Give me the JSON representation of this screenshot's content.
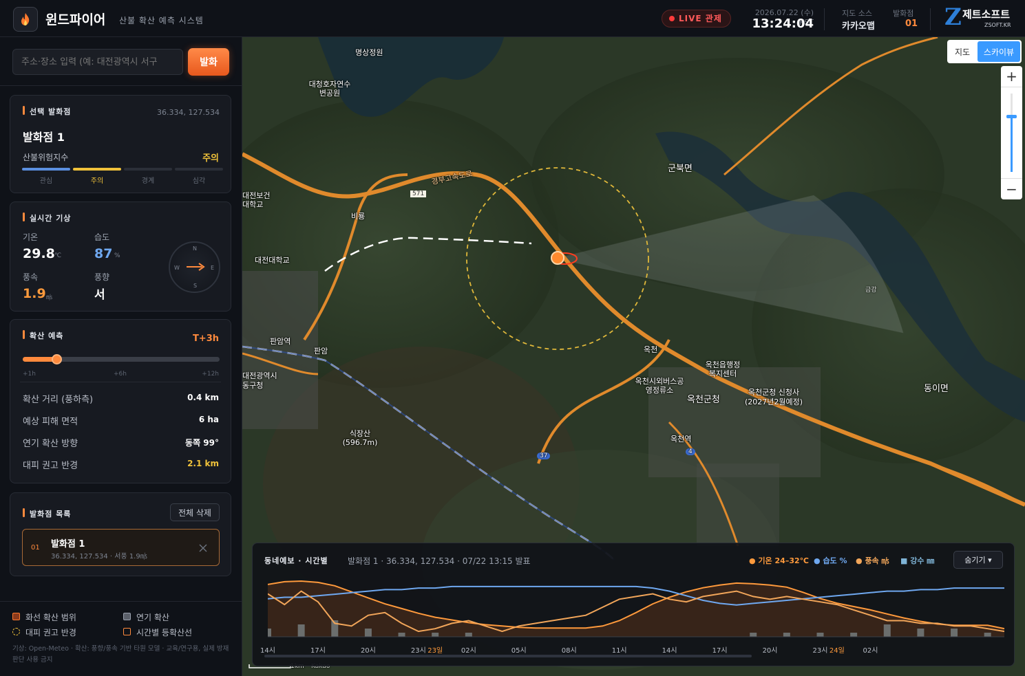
{
  "header": {
    "app_title": "윈드파이어",
    "app_subtitle": "산불 확산 예측 시스템",
    "live_label": "LIVE 관제",
    "date": "2026.07.22 (수) KST",
    "time": "13:24:04",
    "map_source_label": "지도 소스",
    "map_source_value": "카카오맵",
    "ignition_label": "발화점",
    "ignition_value": "01",
    "brand_logo": "Z",
    "brand_name": "제트소프트",
    "brand_url": "ZSOFT.KR"
  },
  "search": {
    "placeholder": "주소·장소 입력 (예: 대전광역시 서구",
    "button": "발화"
  },
  "selected": {
    "title": "선택 발화점",
    "coords": "36.334, 127.534",
    "name": "발화점 1",
    "risk_label": "산불위험지수",
    "risk_value": "주의",
    "risk_levels": [
      "관심",
      "주의",
      "경계",
      "심각"
    ],
    "risk_level_index": 1,
    "risk_colors": [
      "#5b8fe0",
      "#f0c23a",
      "#2b2f38",
      "#2b2f38"
    ]
  },
  "weather": {
    "title": "실시간 기상",
    "temp_label": "기온",
    "temp_value": "29.8",
    "temp_unit": "℃",
    "humidity_label": "습도",
    "humidity_value": "87",
    "humidity_unit": "%",
    "wind_speed_label": "풍속",
    "wind_speed_value": "1.9",
    "wind_speed_unit": "㎧",
    "wind_dir_label": "풍향",
    "wind_dir_value": "서",
    "compass": {
      "n": "N",
      "e": "E",
      "s": "S",
      "w": "W"
    }
  },
  "forecast": {
    "title": "확산 예측",
    "horizon": "T+3h",
    "slider_fraction": 0.17,
    "slider_ticks": [
      "+1h",
      "+6h",
      "+12h"
    ],
    "rows": [
      {
        "label": "확산 거리 (풍하측)",
        "value": "0.4 km"
      },
      {
        "label": "예상 피해 면적",
        "value": "6 ha"
      },
      {
        "label": "연기 확산 방향",
        "value": "동쪽 99°"
      },
      {
        "label": "대피 권고 반경",
        "value": "2.1 km"
      }
    ]
  },
  "ignitions": {
    "title": "발화점 목록",
    "clear_all": "전체 삭제",
    "items": [
      {
        "index": "01",
        "name": "발화점 1",
        "detail": "36.334, 127.534 · 서풍 1.9㎧"
      }
    ]
  },
  "legend": {
    "items": [
      "화선 확산 범위",
      "연기 확산",
      "대피 권고 반경",
      "시간별 등확산선"
    ],
    "note": "기상: Open-Meteo · 확산: 풍향/풍속 기반 타원 모델 · 교육/연구용, 실제 방재 판단 사용 금지"
  },
  "map": {
    "toggle_map": "지도",
    "toggle_sky": "스카이뷰",
    "zoom_in": "+",
    "zoom_out": "−",
    "zoom_level": 0.7,
    "scale": "1km",
    "copyright": "Kakao",
    "labels": [
      "명상정원",
      "대청호자연수변공원",
      "경부고속도로",
      "571",
      "비룡",
      "대전보건대학교",
      "대전대학교",
      "판암역",
      "판암",
      "대전광역시동구청",
      "식장산(596.7m)",
      "군북면",
      "옥천",
      "옥천읍행정복지센터",
      "옥천시외버스공영정류소",
      "옥천군청",
      "옥천군청 신청사(2027년2월예정)",
      "옥천역",
      "동이면",
      "37",
      "4",
      "금강"
    ]
  },
  "chart_data": {
    "type": "line",
    "title": "동네예보 · 시간별",
    "subtitle": "발화점 1 · 36.334, 127.534 · 07/22 13:15 발표",
    "legend": [
      {
        "name": "기온 24–32℃",
        "color": "#ff9a3c"
      },
      {
        "name": "습도 %",
        "color": "#6fa8f0"
      },
      {
        "name": "풍속 ㎧",
        "color": "#f2a65a"
      },
      {
        "name": "강수 ㎜",
        "color": "#7fb4d6"
      }
    ],
    "hide_label": "숨기기",
    "x_ticks": [
      "14시",
      "17시",
      "20시",
      "23시",
      "23일",
      "02시",
      "05시",
      "08시",
      "11시",
      "14시",
      "17시",
      "20시",
      "23시",
      "24일",
      "02시"
    ],
    "hours": 45,
    "temperature": [
      31.4,
      31.8,
      31.9,
      31.7,
      31.2,
      30.3,
      29.4,
      28.5,
      27.8,
      27.1,
      26.5,
      26.1,
      25.7,
      25.4,
      25.2,
      25.0,
      24.9,
      24.9,
      24.9,
      24.9,
      25.2,
      26.0,
      27.2,
      28.5,
      29.5,
      30.3,
      30.9,
      31.3,
      31.6,
      31.5,
      31.3,
      31.0,
      30.2,
      29.3,
      28.6,
      28.1,
      27.6,
      27.0,
      26.4,
      25.9,
      25.5,
      25.3,
      25.3,
      25.3,
      24.8
    ],
    "humidity": [
      83,
      84,
      84,
      85,
      86,
      87,
      88,
      89,
      89,
      90,
      90,
      91,
      91,
      91,
      91,
      91,
      91,
      91,
      91,
      91,
      91,
      91,
      91,
      90,
      88,
      85,
      82,
      80,
      79,
      80,
      81,
      82,
      83,
      84,
      85,
      86,
      87,
      88,
      88,
      89,
      89,
      90,
      90,
      90,
      90
    ],
    "wind_speed": [
      2.5,
      2.1,
      2.6,
      2.2,
      1.4,
      1.3,
      1.7,
      1.8,
      1.4,
      1.1,
      1.2,
      1.4,
      1.5,
      1.3,
      1.1,
      1.3,
      1.4,
      1.5,
      1.6,
      1.7,
      2.0,
      2.3,
      2.4,
      2.5,
      2.3,
      2.2,
      2.4,
      2.5,
      2.6,
      2.4,
      2.3,
      2.4,
      2.3,
      2.2,
      2.1,
      1.9,
      1.7,
      1.5,
      1.5,
      1.4,
      1.4,
      1.3,
      1.3,
      1.2,
      1.1
    ],
    "precipitation": [
      0.4,
      0,
      0.6,
      0,
      0.8,
      0,
      0.4,
      0,
      0.2,
      0,
      0.2,
      0,
      0.2,
      0,
      0,
      0,
      0,
      0,
      0,
      0,
      0,
      0,
      0,
      0,
      0,
      0,
      0,
      0,
      0,
      0.2,
      0,
      0.2,
      0,
      0.2,
      0,
      0.2,
      0,
      0.6,
      0,
      0.4,
      0,
      0.4,
      0,
      0.2,
      0,
      0.2
    ]
  }
}
